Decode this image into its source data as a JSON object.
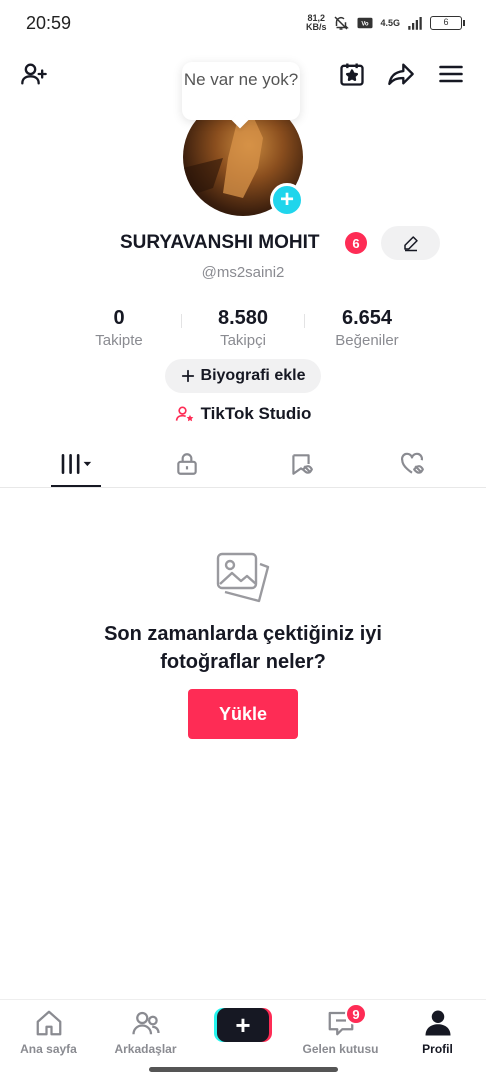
{
  "status_bar": {
    "time": "20:59",
    "net_speed_value": "81,2",
    "net_speed_unit": "KB/s",
    "network_type": "4.5G",
    "battery": "6"
  },
  "top_bar": {
    "icons": [
      "add-user-icon",
      "calendar-star-icon",
      "share-icon",
      "menu-icon"
    ]
  },
  "profile": {
    "bubble_text": "Ne var ne yok?",
    "username": "SURYAVANSHI MOHIT",
    "name_badge": "6",
    "handle": "@ms2saini2",
    "avatar_add": "+",
    "stats": [
      {
        "value": "0",
        "label": "Takipte"
      },
      {
        "value": "8.580",
        "label": "Takipçi"
      },
      {
        "value": "6.654",
        "label": "Beğeniler"
      }
    ],
    "bio_button": "Biyografi ekle",
    "studio_link": "TikTok Studio"
  },
  "tabs": [
    "videos-grid-icon",
    "lock-icon",
    "repost-icon",
    "liked-icon"
  ],
  "empty_state": {
    "text": "Son zamanlarda çektiğiniz iyi fotoğraflar neler?",
    "button": "Yükle"
  },
  "bottom_nav": {
    "items": [
      {
        "label": "Ana sayfa"
      },
      {
        "label": "Arkadaşlar"
      },
      {
        "label": "+"
      },
      {
        "label": "Gelen kutusu",
        "badge": "9"
      },
      {
        "label": "Profil"
      }
    ]
  },
  "colors": {
    "accent": "#fe2c55",
    "cyan": "#20d5ec",
    "text": "#161823",
    "muted": "#8a8b91"
  }
}
